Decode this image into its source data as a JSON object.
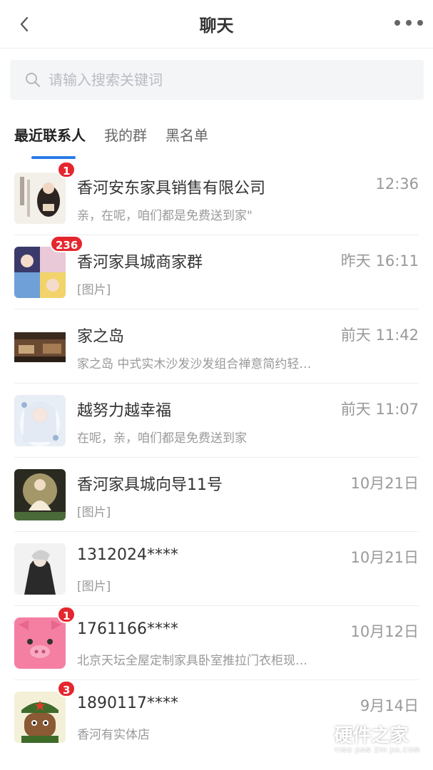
{
  "header": {
    "title": "聊天"
  },
  "search": {
    "placeholder": "请输入搜索关键词"
  },
  "tabs": [
    {
      "label": "最近联系人",
      "active": true
    },
    {
      "label": "我的群",
      "active": false
    },
    {
      "label": "黑名单",
      "active": false
    }
  ],
  "chats": [
    {
      "name": "香河安东家具销售有限公司",
      "time": "12:36",
      "message": "亲，在呢，咱们都是免费送到家\"",
      "badge": "1"
    },
    {
      "name": "香河家具城商家群",
      "time": "昨天 16:11",
      "message": "[图片]",
      "badge": "236"
    },
    {
      "name": "家之岛",
      "time": "前天 11:42",
      "message": "家之岛 中式实木沙发沙发组合禅意简约轻…",
      "badge": ""
    },
    {
      "name": "越努力越幸福",
      "time": "前天 11:07",
      "message": "在呢，亲，咱们都是免费送到家",
      "badge": ""
    },
    {
      "name": "香河家具城向导11号",
      "time": "10月21日",
      "message": "[图片]",
      "badge": ""
    },
    {
      "name": "1312024****",
      "time": "10月21日",
      "message": "[图片]",
      "badge": ""
    },
    {
      "name": "1761166****",
      "time": "10月12日",
      "message": "北京天坛全屋定制家具卧室推拉门衣柜现…",
      "badge": "1"
    },
    {
      "name": "1890117****",
      "time": "9月14日",
      "message": "香河有实体店",
      "badge": "3"
    }
  ],
  "watermark": {
    "main": "硬件之家",
    "sub": "YING JIAN ZHI JIA.COM"
  },
  "colors": {
    "accent": "#2a7be6",
    "badge": "#e5262e"
  }
}
